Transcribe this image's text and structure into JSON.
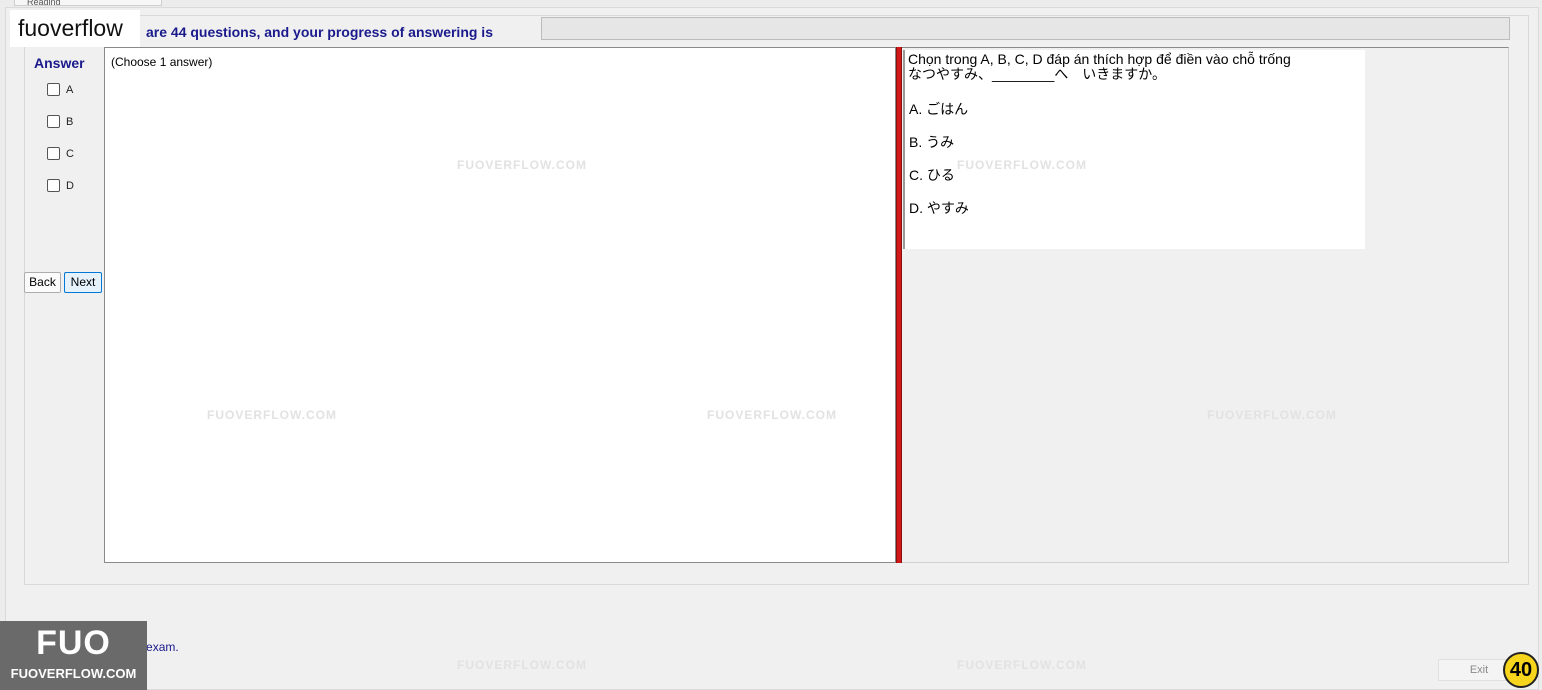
{
  "top_tab_label": "Reading",
  "watermark_text": "fuoverflow",
  "progress": {
    "label": "are 44 questions, and your progress of answering is",
    "value_fraction": 0.0
  },
  "answer_panel": {
    "title": "Answer",
    "options": [
      "A",
      "B",
      "C",
      "D"
    ]
  },
  "nav": {
    "back_label": "Back",
    "next_label": "Next"
  },
  "left_pane": {
    "hint": "(Choose 1 answer)"
  },
  "question": {
    "instruction": "Chọn trong A, B, C, D đáp án thích hợp để điền vào chỗ trống",
    "sentence": "なつやすみ、________へ　いきますか。",
    "choices": [
      "A.  ごはん",
      "B.  うみ",
      "C.  ひる",
      "D.  やすみ"
    ]
  },
  "finish_label": "I want to finish the exam.",
  "logo": {
    "big": "FUO",
    "small": "FUOVERFLOW.COM"
  },
  "exit_label": "Exit",
  "badge_number": "40",
  "watermark_url": "FUOVERFLOW.COM",
  "colors": {
    "accent_red": "#d01818",
    "label_blue": "#1a1a8c",
    "badge_yellow": "#f7d51d"
  }
}
